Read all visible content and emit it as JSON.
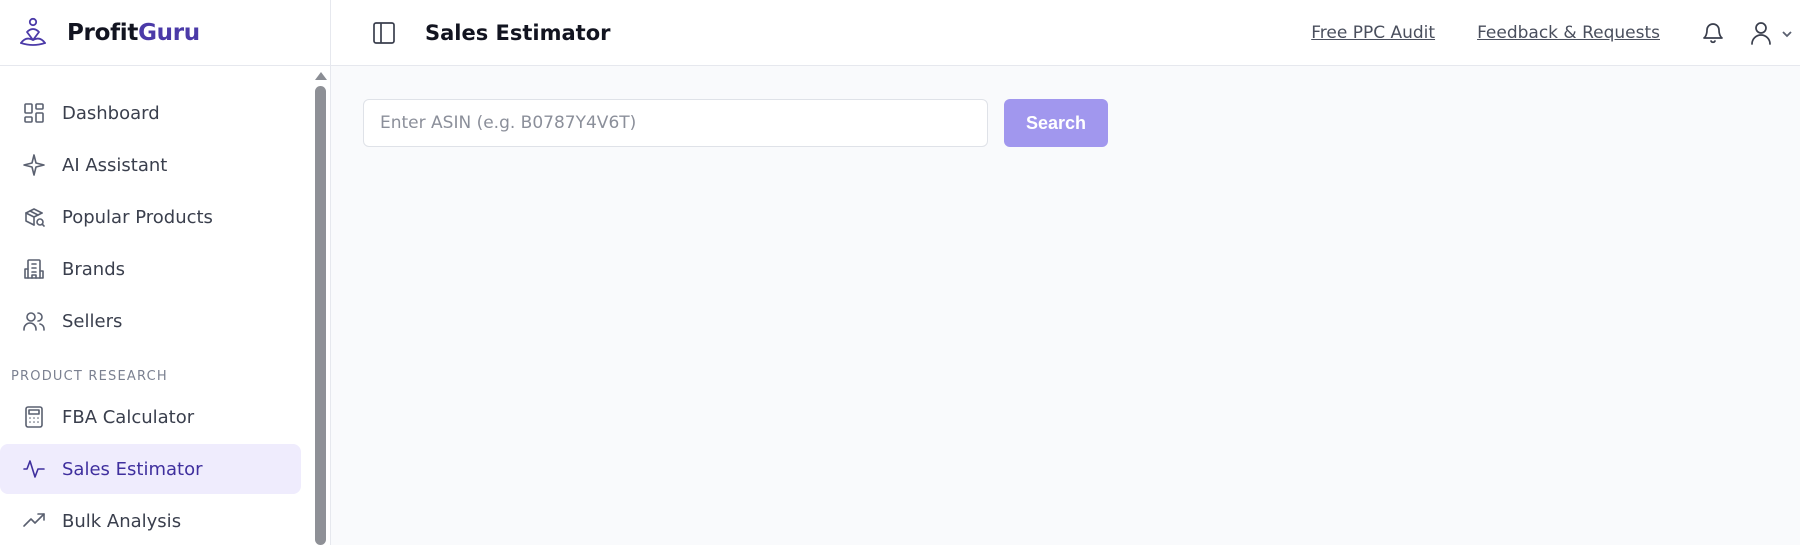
{
  "brand": {
    "name_part1": "Profit",
    "name_part2": "Guru",
    "accent_color": "#4b3aa8"
  },
  "sidebar": {
    "items": [
      {
        "label": "Dashboard",
        "icon": "grid-icon"
      },
      {
        "label": "AI Assistant",
        "icon": "sparkle-icon"
      },
      {
        "label": "Popular Products",
        "icon": "box-search-icon"
      },
      {
        "label": "Brands",
        "icon": "building-icon"
      },
      {
        "label": "Sellers",
        "icon": "users-icon"
      }
    ],
    "section_label": "PRODUCT RESEARCH",
    "research_items": [
      {
        "label": "FBA Calculator",
        "icon": "calculator-icon"
      },
      {
        "label": "Sales Estimator",
        "icon": "activity-icon",
        "active": true
      },
      {
        "label": "Bulk Analysis",
        "icon": "trending-up-icon"
      }
    ]
  },
  "header": {
    "title": "Sales Estimator",
    "links": [
      "Free PPC Audit",
      "Feedback & Requests"
    ]
  },
  "search": {
    "placeholder": "Enter ASIN (e.g. B0787Y4V6T)",
    "value": "",
    "button_label": "Search",
    "button_color": "#a197ee"
  }
}
